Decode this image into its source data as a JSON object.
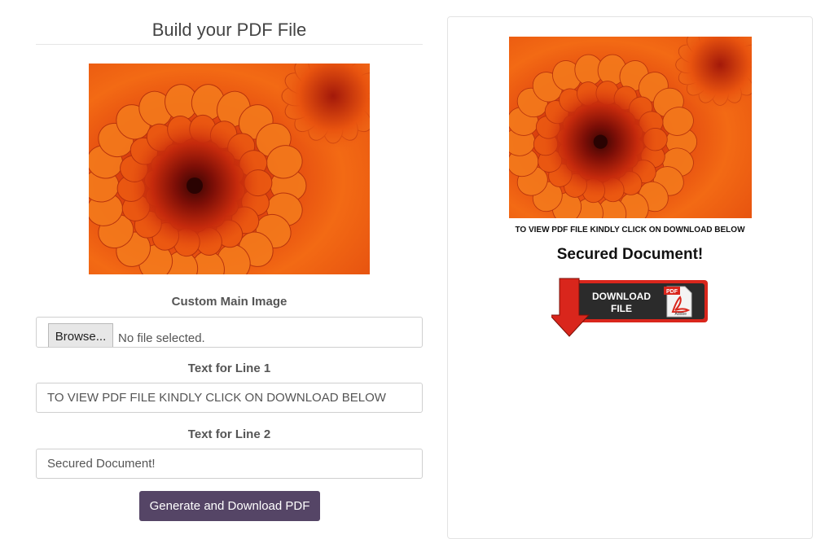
{
  "page": {
    "title": "Build your PDF File"
  },
  "main_image": {
    "icon": "flower-image"
  },
  "form": {
    "image_label": "Custom Main Image",
    "browse_label": "Browse...",
    "file_status": "No file selected.",
    "line1_label": "Text for Line 1",
    "line1_value": "TO VIEW PDF FILE KINDLY CLICK ON DOWNLOAD BELOW",
    "line2_label": "Text for Line 2",
    "line2_value": "Secured Document!",
    "generate_label": "Generate and Download PDF"
  },
  "preview": {
    "line1": "TO VIEW PDF FILE KINDLY CLICK ON DOWNLOAD BELOW",
    "line2": "Secured Document!",
    "download_text_1": "DOWNLOAD",
    "download_text_2": "FILE",
    "pdf_tag": "PDF",
    "adobe_tag": "Adobe"
  },
  "colors": {
    "accent_button": "#554566",
    "badge_red": "#d9261c",
    "badge_dark": "#2b2b2b"
  }
}
